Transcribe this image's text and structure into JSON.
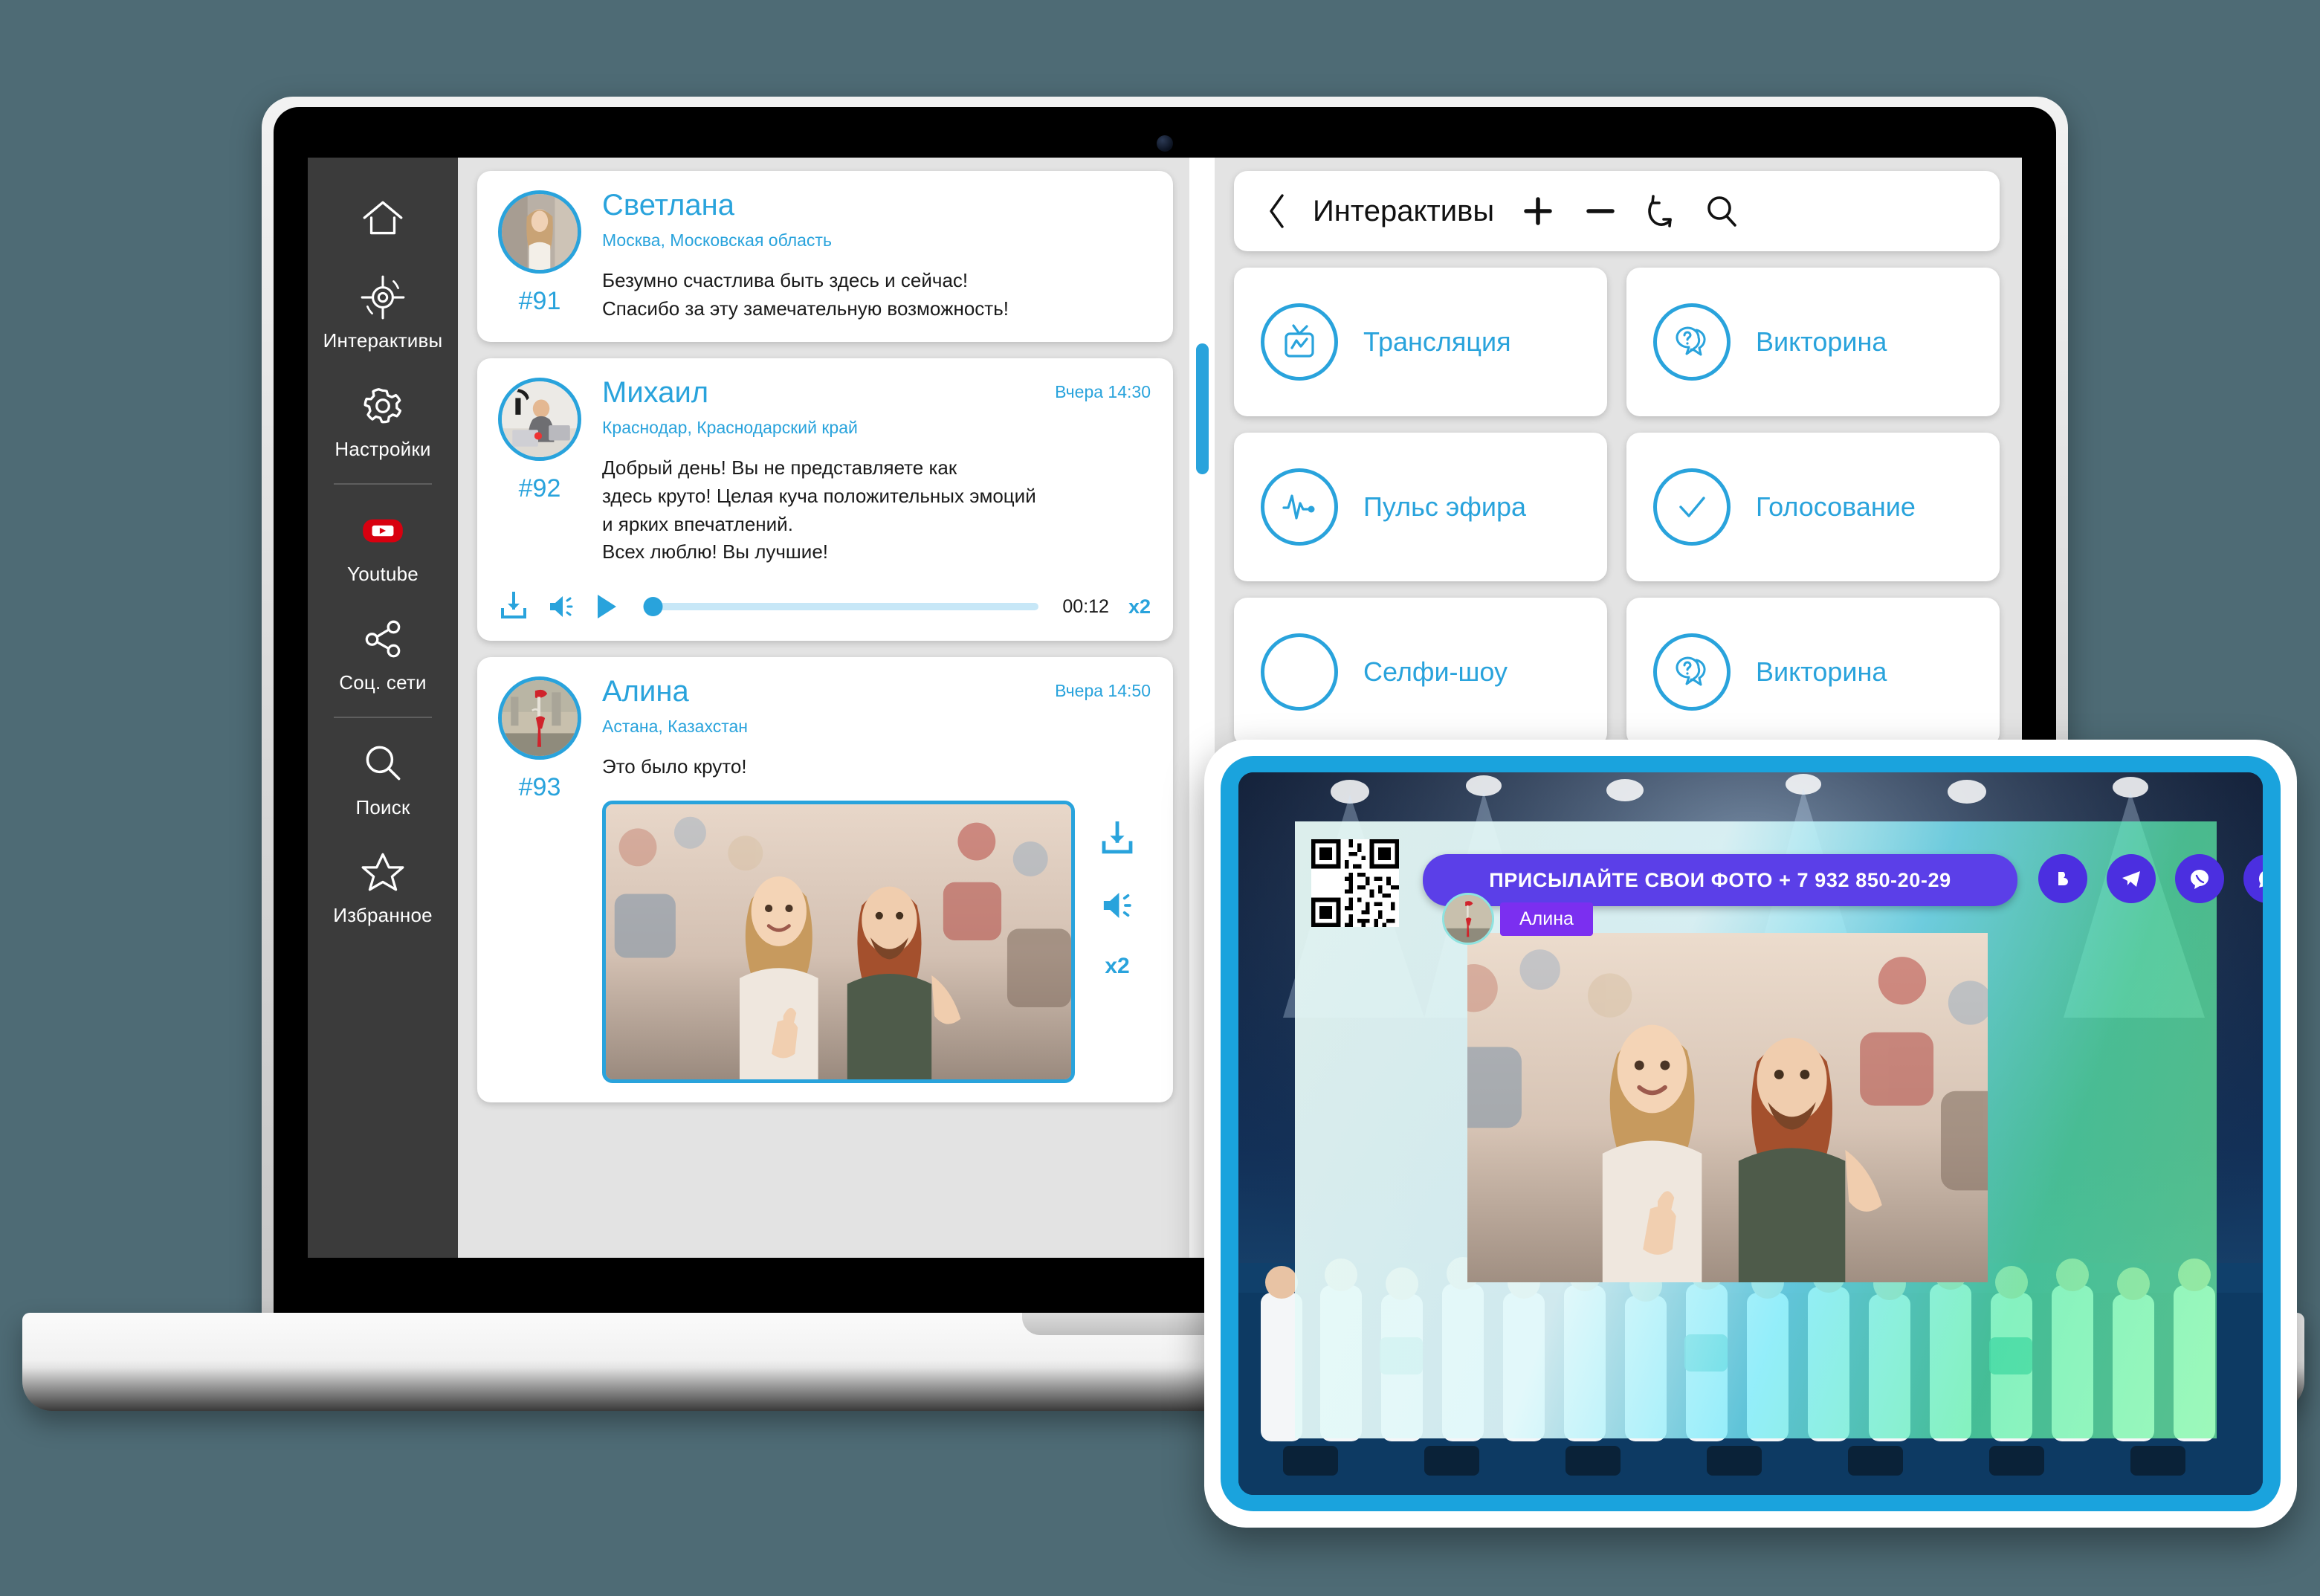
{
  "sidebar": {
    "items": [
      {
        "label": "",
        "icon": "home-icon",
        "name": "home"
      },
      {
        "label": "Интерактивы",
        "icon": "target-icon",
        "name": "interactives"
      },
      {
        "label": "Настройки",
        "icon": "gear-icon",
        "name": "settings"
      },
      {
        "label": "Youtube",
        "icon": "youtube-icon",
        "name": "youtube"
      },
      {
        "label": "Соц. сети",
        "icon": "share-icon",
        "name": "social"
      },
      {
        "label": "Поиск",
        "icon": "search-icon",
        "name": "search"
      },
      {
        "label": "Избранное",
        "icon": "star-icon",
        "name": "favorites"
      }
    ]
  },
  "feed": {
    "messages": [
      {
        "id": "#91",
        "name": "Светлана",
        "location": "Москва, Московская область",
        "time": "",
        "text": "Безумно счастлива быть здесь и сейчас!\nСпасибо за эту замечательную возможность!"
      },
      {
        "id": "#92",
        "name": "Михаил",
        "location": "Краснодар, Краснодарский край",
        "time": "Вчера 14:30",
        "text": "Добрый день! Вы не представляете как\nздесь круто!  Целая куча положительных эмоций\nи ярких впечатлений.\n Всех люблю! Вы лучшие!",
        "audio": {
          "duration": "00:12",
          "rate": "x2",
          "progress_percent": 2
        }
      },
      {
        "id": "#93",
        "name": "Алина",
        "location": "Астана, Казахстан",
        "time": "Вчера 14:50",
        "text": "Это было круто!",
        "photo_actions": {
          "rate": "x2"
        }
      }
    ]
  },
  "panel": {
    "back_icon": "chevron-left-icon",
    "title": "Интерактивы",
    "add_icon": "plus-icon",
    "remove_icon": "minus-icon",
    "refresh_icon": "refresh-icon",
    "search_icon": "search-icon",
    "tiles": [
      {
        "label": "Трансляция",
        "icon": "tv-icon"
      },
      {
        "label": "Викторина",
        "icon": "question-bubble-icon"
      },
      {
        "label": "Пульс эфира",
        "icon": "pulse-icon"
      },
      {
        "label": "Голосование",
        "icon": "check-icon"
      },
      {
        "label": "Селфи-шоу",
        "icon": "circle-icon"
      },
      {
        "label": "Викторина",
        "icon": "question-bubble-icon"
      }
    ]
  },
  "tablet": {
    "banner_text": "ПРИСЫЛАЙТЕ СВОИ ФОТО + 7 932 850-20-29",
    "tag_name": "Алина",
    "qr_alt": "qr-code",
    "socials": [
      {
        "name": "vk",
        "glyph": "B"
      },
      {
        "name": "telegram",
        "glyph": ""
      },
      {
        "name": "viber",
        "glyph": ""
      },
      {
        "name": "whatsapp",
        "glyph": ""
      }
    ]
  },
  "colors": {
    "accent": "#29a3dc",
    "sidebar_bg": "#3b3b3b",
    "panel_bg": "#e3e3e3",
    "tablet_frame": "#1aa3dd",
    "banner_purple": "#5b3fe8",
    "page_bg": "#4e6b75"
  }
}
